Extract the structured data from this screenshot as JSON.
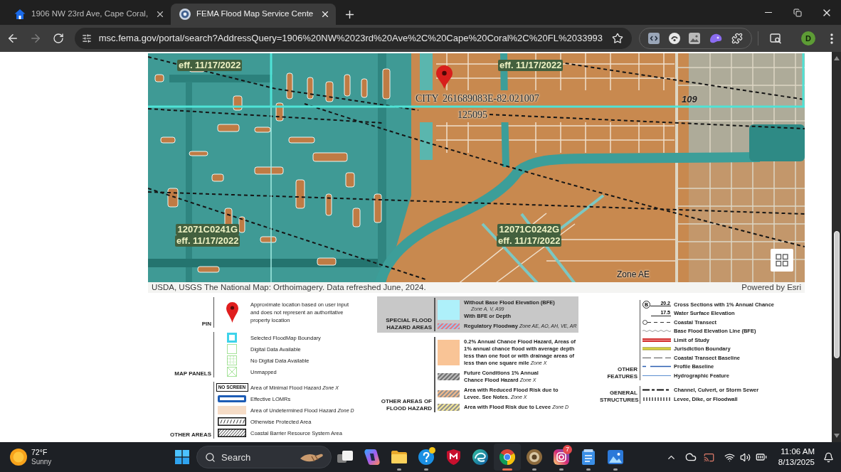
{
  "browser": {
    "tabs": [
      {
        "title": "1906 NW 23rd Ave, Cape Coral,",
        "kind": "house",
        "selected": false
      },
      {
        "title": "FEMA Flood Map Service Cente",
        "kind": "seal",
        "selected": true
      }
    ],
    "can_go_back": true,
    "can_go_forward": false,
    "url": "msc.fema.gov/portal/search?AddressQuery=1906%20NW%2023rd%20Ave%2C%20Cape%20Coral%2C%20FL%2033993",
    "profile_initial": "D"
  },
  "map": {
    "labels": [
      {
        "kind": "panel",
        "effective": "eff. 11/17/2022"
      },
      {
        "kind": "panel",
        "effective": "eff. 11/17/2022"
      },
      {
        "kind": "place",
        "text": "CITY"
      },
      {
        "kind": "coords",
        "text": "261689083E-82.021007"
      },
      {
        "kind": "community",
        "text": "125095"
      },
      {
        "kind": "route",
        "text": "109"
      },
      {
        "kind": "panel",
        "id": "12071C0241G",
        "effective": "eff. 11/17/2022"
      },
      {
        "kind": "panel",
        "id": "12071C0242G",
        "effective": "eff. 11/17/2022"
      },
      {
        "kind": "zone",
        "text": "Zone AE"
      }
    ],
    "attribution": "USDA, USGS The National Map: Orthoimagery. Data refreshed June, 2024.",
    "credit": "Powered by Esri"
  },
  "legend": {
    "columns": [
      {
        "groups": [
          {
            "title": "PIN",
            "shaded": false,
            "items": [
              {
                "kind": "pin",
                "label": "Approximate location based on user input and does not represent an authoritative property location"
              }
            ]
          },
          {
            "title": "MAP PANELS",
            "shaded": false,
            "items": [
              {
                "kind": "selected",
                "label": "Selected FloodMap Boundary"
              },
              {
                "kind": "digital",
                "label": "Digital Data Available"
              },
              {
                "kind": "nodigital",
                "label": "No Digital Data Available"
              },
              {
                "kind": "unmapped",
                "label": "Unmapped"
              }
            ]
          },
          {
            "title": "OTHER AREAS",
            "shaded": false,
            "items": [
              {
                "kind": "noscreen",
                "swatch_text": "NO SCREEN",
                "label": "Area of Minimal Flood Hazard *Zone X*"
              },
              {
                "kind": "lomr",
                "label": "Effective LOMRs"
              },
              {
                "kind": "undetermined",
                "label": "Area of Undetermined Flood Hazard *Zone D*"
              },
              {
                "kind": "protected",
                "label": "Otherwise Protected Area"
              },
              {
                "kind": "cbrs",
                "label": "Coastal Barrier Resource System Area"
              }
            ]
          }
        ]
      },
      {
        "groups": [
          {
            "title": "SPECIAL FLOOD HAZARD AREAS",
            "shaded": true,
            "items": [
              {
                "kind": "sfha",
                "label": "Without Base Flood Elevation (BFE)",
                "note": "Zone A, V, A99",
                "label_2": "With BFE or Depth"
              },
              {
                "kind": "floodway",
                "label": "Regulatory Floodway *Zone AE, AO, AH, VE, AR*"
              }
            ]
          },
          {
            "title": "OTHER AREAS OF FLOOD HAZARD",
            "shaded": false,
            "items": [
              {
                "kind": "orange",
                "label": "0.2% Annual Chance Flood Hazard, Areas of 1% annual chance flood with average depth less than one foot or with drainage areas of less than one square mile *Zone X*"
              },
              {
                "kind": "future",
                "label": "Future Conditions 1% Annual Chance Flood Hazard *Zone X*"
              },
              {
                "kind": "reduced",
                "label": "Area with Reduced Flood Risk due to Levee. See Notes. *Zone X*"
              },
              {
                "kind": "leveerisk",
                "label": "Area with Flood Risk due to Levee *Zone D*"
              }
            ]
          }
        ]
      },
      {
        "groups": [
          {
            "title": "OTHER FEATURES",
            "shaded": false,
            "items": [
              {
                "kind": "crosssection",
                "marker": "B",
                "elevation": "20.2",
                "label": "Cross Sections with 1% Annual Chance"
              },
              {
                "kind": "wse",
                "elevation": "17.5",
                "label": "Water Surface Elevation"
              },
              {
                "kind": "transect",
                "label": "Coastal Transect"
              },
              {
                "kind": "bfe",
                "label": "Base Flood Elevation Line (BFE)"
              },
              {
                "kind": "limit",
                "label": "Limit of Study"
              },
              {
                "kind": "jurisdiction",
                "label": "Jurisdiction Boundary"
              },
              {
                "kind": "baseline",
                "label": "Coastal Transect Baseline"
              },
              {
                "kind": "profile",
                "label": "Profile Baseline"
              },
              {
                "kind": "hydro",
                "label": "Hydrographic Feature"
              }
            ]
          },
          {
            "title": "GENERAL STRUCTURES",
            "shaded": false,
            "items": [
              {
                "kind": "channel",
                "label": "Channel, Culvert, or Storm Sewer"
              },
              {
                "kind": "floodwall",
                "label": "Levee, Dike, or Floodwall"
              }
            ]
          }
        ]
      }
    ]
  },
  "taskbar": {
    "weather": {
      "temperature": "72°F",
      "condition": "Sunny"
    },
    "search": {
      "placeholder": "Search"
    },
    "apps": [
      {
        "kind": "taskview",
        "open": false,
        "selected": false,
        "alert": false
      },
      {
        "kind": "copilot",
        "open": false,
        "selected": false,
        "alert": false
      },
      {
        "kind": "explorer",
        "open": true,
        "selected": false,
        "alert": false
      },
      {
        "kind": "help",
        "open": true,
        "selected": false,
        "alert": true
      },
      {
        "kind": "shield",
        "open": false,
        "selected": false,
        "alert": false
      },
      {
        "kind": "edge",
        "open": false,
        "selected": false,
        "alert": false
      },
      {
        "kind": "chrome",
        "open": true,
        "selected": true,
        "alert": false
      },
      {
        "kind": "gear",
        "open": true,
        "selected": false,
        "alert": false
      },
      {
        "kind": "instagram",
        "open": true,
        "selected": false,
        "alert": false,
        "badge": "7"
      },
      {
        "kind": "notepad",
        "open": true,
        "selected": false,
        "alert": false
      },
      {
        "kind": "photos",
        "open": true,
        "selected": false,
        "alert": false
      }
    ],
    "clock": {
      "time": "11:06 AM",
      "date": "8/13/2025"
    }
  }
}
